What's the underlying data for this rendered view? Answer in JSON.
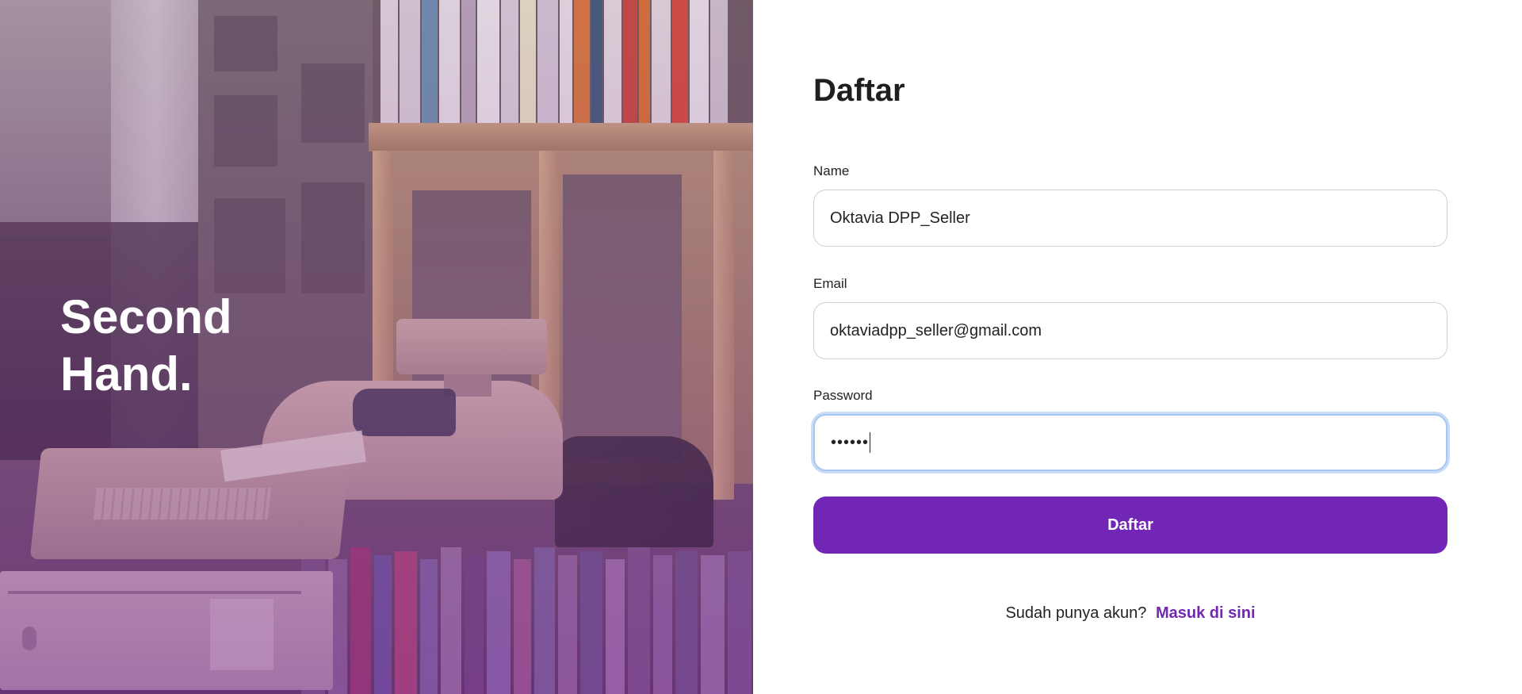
{
  "hero": {
    "title": "Second\nHand."
  },
  "form": {
    "title": "Daftar",
    "name": {
      "label": "Name",
      "value": "Oktavia DPP_Seller"
    },
    "email": {
      "label": "Email",
      "value": "oktaviadpp_seller@gmail.com"
    },
    "password": {
      "label": "Password",
      "value": "••••••"
    },
    "submit_label": "Daftar",
    "signin_prompt": "Sudah punya akun?",
    "signin_link": "Masuk di sini"
  },
  "colors": {
    "accent": "#7126B5",
    "focus_ring": "#A8C7F0"
  }
}
